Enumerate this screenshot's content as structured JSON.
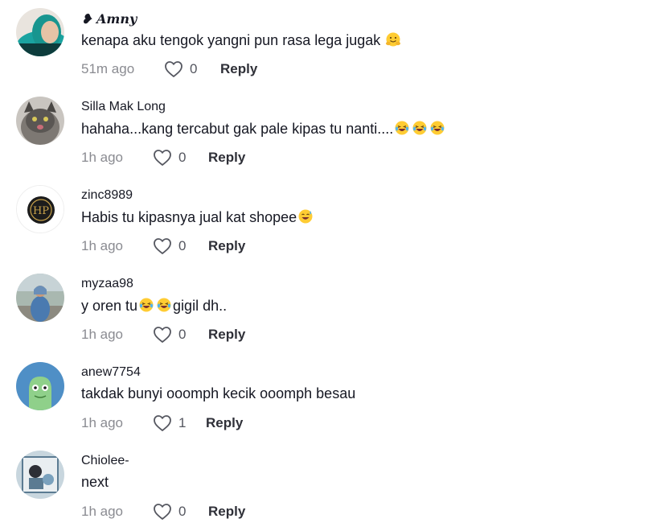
{
  "comments": [
    {
      "username": "Amny",
      "text_parts": [
        "kenapa aku tengok yangni pun rasa lega jugak "
      ],
      "time": "51m ago",
      "likes": "0",
      "reply_label": "Reply",
      "avatar_colors": [
        "#1aa3a0",
        "#0e4d4d"
      ],
      "emoji": [
        "hug-face"
      ]
    },
    {
      "username": "Silla Mak Long",
      "text_parts": [
        "hahaha...kang tercabut gak pale kipas tu nanti...."
      ],
      "time": "1h ago",
      "likes": "0",
      "reply_label": "Reply",
      "avatar_colors": [
        "#b9b6b2",
        "#3c3a38"
      ],
      "emoji": [
        "laughing-face",
        "laughing-face",
        "laughing-face"
      ]
    },
    {
      "username": "zinc8989",
      "text_parts": [
        "Habis tu kipasnya jual kat shopee"
      ],
      "time": "1h ago",
      "likes": "0",
      "reply_label": "Reply",
      "avatar_colors": [
        "#ffffff",
        "#1c1c1c"
      ],
      "emoji": [
        "sweat-smile-face"
      ]
    },
    {
      "username": "myzaa98",
      "text_parts": [
        "y oren tu",
        "gigil dh.."
      ],
      "time": "1h ago",
      "likes": "0",
      "reply_label": "Reply",
      "avatar_colors": [
        "#9fb0a8",
        "#4a6a86"
      ],
      "emoji": [
        "laughing-face",
        "laughing-face"
      ]
    },
    {
      "username": "anew7754",
      "text_parts": [
        "takdak bunyi ooomph kecik ooomph besau"
      ],
      "time": "1h ago",
      "likes": "1",
      "reply_label": "Reply",
      "avatar_colors": [
        "#4f8fc6",
        "#8fd08a"
      ],
      "emoji": []
    },
    {
      "username": "Chiolee-",
      "text_parts": [
        "next"
      ],
      "time": "1h ago",
      "likes": "0",
      "reply_label": "Reply",
      "avatar_colors": [
        "#c8d6de",
        "#5b7b92"
      ],
      "emoji": []
    }
  ],
  "colors": {
    "text": "#161823",
    "muted": "#8a8b91",
    "reply": "#2f3038",
    "emoji_yellow": "#ffcc33"
  }
}
